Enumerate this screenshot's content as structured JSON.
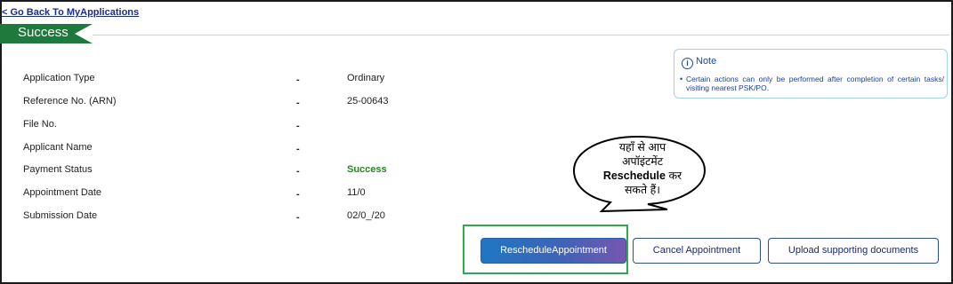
{
  "nav": {
    "back_link": "< Go Back To MyApplications"
  },
  "banner": {
    "title": "Success",
    "color": "#1e7a3c"
  },
  "details": {
    "rows": [
      {
        "label": "Application Type",
        "separator": "-",
        "value": "Ordinary"
      },
      {
        "label": "Reference No. (ARN)",
        "separator": "-",
        "value": "25-00643"
      },
      {
        "label": "File No.",
        "separator": "-",
        "value": ""
      },
      {
        "label": "Applicant Name",
        "separator": "-",
        "value": ""
      },
      {
        "label": "Payment Status",
        "separator": "-",
        "value": "Success"
      },
      {
        "label": "Appointment Date",
        "separator": "-",
        "value": "11/0"
      },
      {
        "label": "Submission Date",
        "separator": "-",
        "value": "02/0_/20"
      }
    ]
  },
  "note": {
    "icon": "info-icon",
    "title": "Note",
    "bullet": "•",
    "text": "Certain actions can only be performed after completion of certain tasks/ visiting nearest PSK/PO."
  },
  "callout": {
    "line1": "यहाँ से आप",
    "line2": "अपॉइंटमेंट",
    "line3_bold": "Reschedule",
    "line3_rest": " कर",
    "line4": "सकते हैं।"
  },
  "actions": {
    "reschedule": "RescheduleAppointment",
    "cancel": "Cancel Appointment",
    "upload": "Upload supporting documents"
  },
  "colors": {
    "success_green": "#1e8a1e",
    "highlight_border": "#2fa84f",
    "link_blue": "#1a2d8c"
  }
}
